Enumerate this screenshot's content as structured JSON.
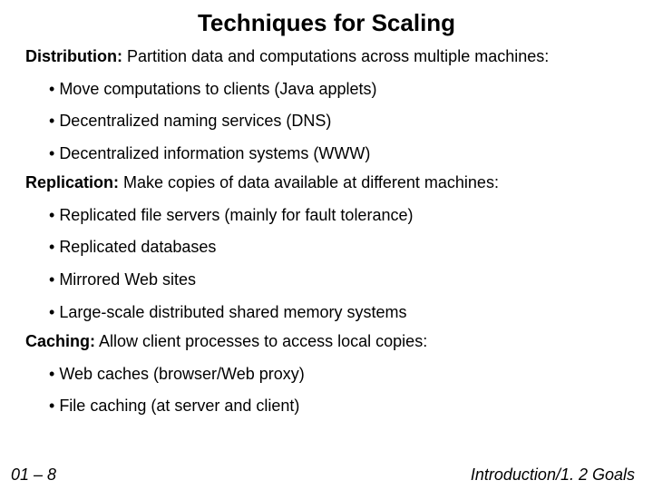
{
  "title": "Techniques for Scaling",
  "sections": [
    {
      "heading": "Distribution:",
      "desc": "Partition data and computations across multiple machines:",
      "items": [
        "Move computations to clients (Java applets)",
        "Decentralized naming services (DNS)",
        "Decentralized information systems (WWW)"
      ]
    },
    {
      "heading": "Replication:",
      "desc": "Make copies of data available at different machines:",
      "items": [
        "Replicated file servers (mainly for fault tolerance)",
        "Replicated databases",
        "Mirrored Web sites",
        "Large-scale distributed shared memory systems"
      ]
    },
    {
      "heading": "Caching:",
      "desc": "Allow client processes to access local copies:",
      "items": [
        "Web caches (browser/Web proxy)",
        "File caching (at server and client)"
      ]
    }
  ],
  "footer": {
    "left": "01 – 8",
    "right": "Introduction/1. 2 Goals"
  }
}
